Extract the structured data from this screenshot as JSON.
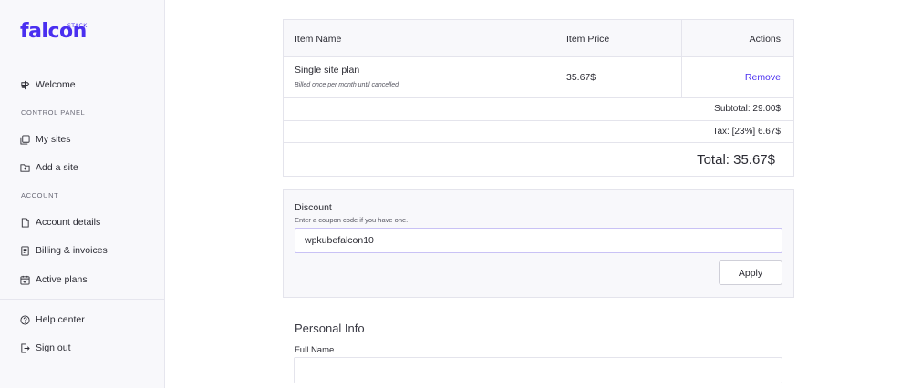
{
  "brand": {
    "name": "falcon",
    "stack": "STACK",
    "color": "#4a2ff0"
  },
  "sidebar": {
    "welcome": {
      "label": "Welcome",
      "icon": "signpost-icon"
    },
    "sections": [
      {
        "title": "CONTROL PANEL",
        "items": [
          {
            "label": "My sites",
            "icon": "sites-icon"
          },
          {
            "label": "Add a site",
            "icon": "folder-plus-icon"
          }
        ]
      },
      {
        "title": "ACCOUNT",
        "items": [
          {
            "label": "Account details",
            "icon": "document-icon"
          },
          {
            "label": "Billing & invoices",
            "icon": "receipt-icon"
          },
          {
            "label": "Active plans",
            "icon": "calendar-check-icon"
          }
        ]
      }
    ],
    "footer": [
      {
        "label": "Help center",
        "icon": "help-circle-icon"
      },
      {
        "label": "Sign out",
        "icon": "sign-out-icon"
      }
    ]
  },
  "cart": {
    "headers": [
      "Item Name",
      "Item Price",
      "Actions"
    ],
    "item": {
      "name": "Single site plan",
      "note": "Billed once per month until cancelled",
      "price": "35.67$",
      "action": "Remove"
    },
    "subtotal": "Subtotal: 29.00$",
    "tax": "Tax: [23%] 6.67$",
    "total": "Total: 35.67$"
  },
  "discount": {
    "title": "Discount",
    "help": "Enter a coupon code if you have one.",
    "code": "wpkubefalcon10",
    "apply_label": "Apply"
  },
  "personal_info": {
    "title": "Personal Info",
    "full_name_label": "Full Name",
    "full_name_value": ""
  }
}
